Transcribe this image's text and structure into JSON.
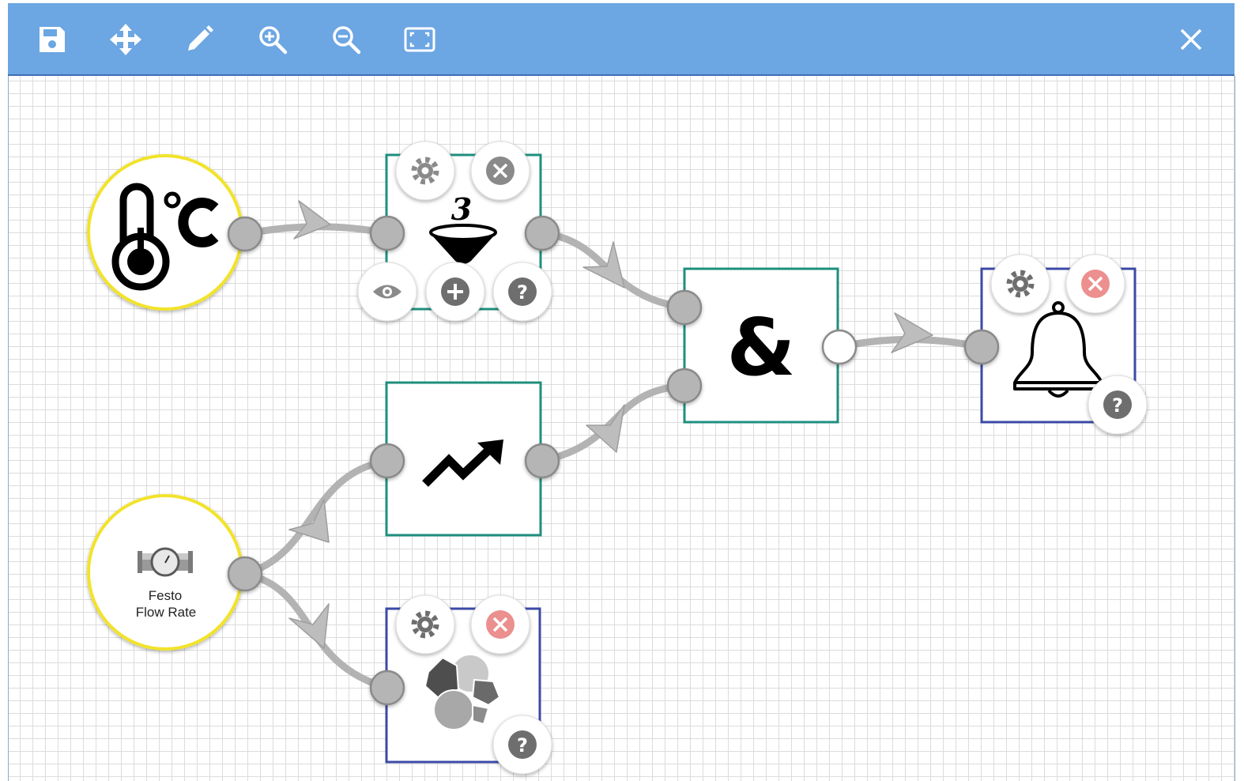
{
  "toolbar": {
    "buttons": [
      {
        "id": "save",
        "icon": "save-icon"
      },
      {
        "id": "move",
        "icon": "move-icon"
      },
      {
        "id": "edit",
        "icon": "pencil-icon"
      },
      {
        "id": "zoom_in",
        "icon": "zoom-in-icon"
      },
      {
        "id": "zoom_out",
        "icon": "zoom-out-icon"
      },
      {
        "id": "fit",
        "icon": "fit-screen-icon"
      }
    ],
    "close_icon": "close-icon"
  },
  "nodes": {
    "temperature": {
      "type": "source",
      "icon": "thermometer-celsius-icon"
    },
    "flow_rate": {
      "type": "source",
      "icon": "flow-meter-icon",
      "label_line1": "Festo",
      "label_line2": "Flow Rate"
    },
    "filter": {
      "type": "operator",
      "icon": "funnel-icon",
      "badge": "3"
    },
    "trend": {
      "type": "operator",
      "icon": "trending-up-icon"
    },
    "and": {
      "type": "operator",
      "icon": "ampersand-icon",
      "symbol": "&"
    },
    "cluster": {
      "type": "sink",
      "icon": "cluster-icon"
    },
    "alarm": {
      "type": "sink",
      "icon": "bell-icon"
    }
  },
  "node_actions": {
    "filter": [
      "settings",
      "delete",
      "view",
      "add",
      "help"
    ],
    "cluster": [
      "settings",
      "delete",
      "help"
    ],
    "alarm": [
      "settings",
      "delete",
      "help"
    ]
  },
  "colors": {
    "toolbar": "#6ca6e3",
    "source_border": "#f2e32b",
    "operator_border": "#1f8f7e",
    "sink_border": "#3b4aa6",
    "edge": "#b3b3b3",
    "port": "#b5b5b5",
    "delete_active": "#ec8f8f",
    "delete_inactive": "#8a8a8a"
  }
}
